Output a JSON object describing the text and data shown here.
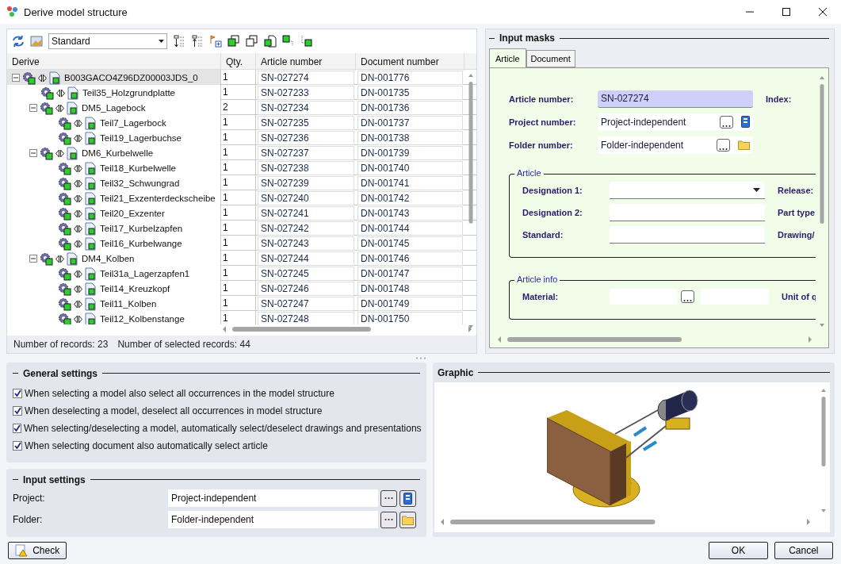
{
  "window": {
    "title": "Derive model structure"
  },
  "toolbar": {
    "view": "Standard"
  },
  "tree": {
    "columns": [
      "Derive",
      "Qty.",
      "Article number",
      "Document number"
    ],
    "rows": [
      {
        "name": "B003GACO4Z96DZ00003JDS_0",
        "qty": "1",
        "article_number": "SN-027274",
        "document_number": "DN-001776",
        "selected": true,
        "expanded": true,
        "children": [
          {
            "name": "Teil35_Holzgrundplatte",
            "qty": "1",
            "article_number": "SN-027233",
            "document_number": "DN-001735",
            "selected": false
          },
          {
            "name": "DM5_Lagebock",
            "qty": "2",
            "article_number": "SN-027234",
            "document_number": "DN-001736",
            "selected": false,
            "expanded": true,
            "children": [
              {
                "name": "Teil7_Lagerbock",
                "qty": "1",
                "article_number": "SN-027235",
                "document_number": "DN-001737",
                "selected": false
              },
              {
                "name": "Teil19_Lagerbuchse",
                "qty": "1",
                "article_number": "SN-027236",
                "document_number": "DN-001738",
                "selected": false
              }
            ]
          },
          {
            "name": "DM6_Kurbelwelle",
            "qty": "1",
            "article_number": "SN-027237",
            "document_number": "DN-001739",
            "selected": false,
            "expanded": true,
            "children": [
              {
                "name": "Teil18_Kurbelwelle",
                "qty": "1",
                "article_number": "SN-027238",
                "document_number": "DN-001740",
                "selected": false
              },
              {
                "name": "Teil32_Schwungrad",
                "qty": "1",
                "article_number": "SN-027239",
                "document_number": "DN-001741",
                "selected": false
              },
              {
                "name": "Teil21_Exzenterdeckscheibe",
                "qty": "1",
                "article_number": "SN-027240",
                "document_number": "DN-001742",
                "selected": false
              },
              {
                "name": "Teil20_Exzenter",
                "qty": "1",
                "article_number": "SN-027241",
                "document_number": "DN-001743",
                "selected": false
              },
              {
                "name": "Teil17_Kurbelzapfen",
                "qty": "1",
                "article_number": "SN-027242",
                "document_number": "DN-001744",
                "selected": false
              },
              {
                "name": "Teil16_Kurbelwange",
                "qty": "1",
                "article_number": "SN-027243",
                "document_number": "DN-001745",
                "selected": false
              }
            ]
          },
          {
            "name": "DM4_Kolben",
            "qty": "1",
            "article_number": "SN-027244",
            "document_number": "DN-001746",
            "selected": false,
            "expanded": true,
            "children": [
              {
                "name": "Teil31a_Lagerzapfen1",
                "qty": "1",
                "article_number": "SN-027245",
                "document_number": "DN-001747",
                "selected": false
              },
              {
                "name": "Teil14_Kreuzkopf",
                "qty": "1",
                "article_number": "SN-027246",
                "document_number": "DN-001748",
                "selected": false
              },
              {
                "name": "Teil11_Kolben",
                "qty": "1",
                "article_number": "SN-027247",
                "document_number": "DN-001749",
                "selected": false
              },
              {
                "name": "Teil12_Kolbenstange",
                "qty": "1",
                "article_number": "SN-027248",
                "document_number": "DN-001750",
                "selected": false
              }
            ]
          }
        ]
      }
    ]
  },
  "status_bar": {
    "records": "Number of records: 23",
    "selected_records": "Number of selected records: 44"
  },
  "input_masks": {
    "title": "Input masks",
    "tabs": [
      {
        "label": "Article",
        "selected": true
      },
      {
        "label": "Document",
        "selected": false
      }
    ],
    "header_fields": [
      {
        "label": "Article number:",
        "value": "SN-027274",
        "kind": "highlighted"
      },
      {
        "label": "Project number:",
        "value": "Project-independent",
        "kind": "project"
      },
      {
        "label": "Folder number:",
        "value": "Folder-independent",
        "kind": "folder"
      }
    ],
    "index_label": "Index:",
    "groups": [
      {
        "title": "Article",
        "fields": [
          {
            "label": "Designation 1:",
            "kind": "dropdown",
            "side_label": "Release:"
          },
          {
            "label": "Designation 2:",
            "kind": "text",
            "side_label": "Part type"
          },
          {
            "label": "Standard:",
            "kind": "text",
            "side_label": "Drawing/"
          }
        ]
      },
      {
        "title": "Article info",
        "fields": [
          {
            "label": "Material:",
            "kind": "lookup",
            "side_label": "Unit of q"
          }
        ]
      }
    ]
  },
  "general_settings": {
    "title": "General settings",
    "options": [
      {
        "label": "When selecting a model also select all occurrences in the model structure",
        "checked": true
      },
      {
        "label": "When deselecting a model, deselect all occurrences in model structure",
        "checked": true
      },
      {
        "label": "When selecting/deselecting a model, automatically select/deselect drawings and presentations",
        "checked": true
      },
      {
        "label": "When selecting document also automatically select article",
        "checked": true
      }
    ]
  },
  "input_settings": {
    "title": "Input settings",
    "fields": [
      {
        "label": "Project:",
        "value": "Project-independent",
        "kind": "project"
      },
      {
        "label": "Folder:",
        "value": "Folder-independent",
        "kind": "folder"
      }
    ]
  },
  "graphic": {
    "title": "Graphic"
  },
  "buttons": {
    "check": "Check",
    "ok": "OK",
    "cancel": "Cancel"
  }
}
